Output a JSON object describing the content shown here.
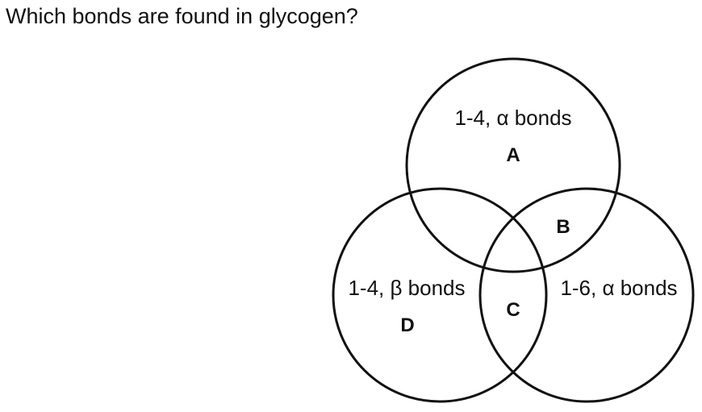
{
  "question": "Which bonds are found in glycogen?",
  "sets": {
    "top": "1-4, α bonds",
    "left": "1-4, β bonds",
    "right": "1-6, α bonds"
  },
  "regions": {
    "a": "A",
    "b": "B",
    "c": "C",
    "d": "D"
  }
}
